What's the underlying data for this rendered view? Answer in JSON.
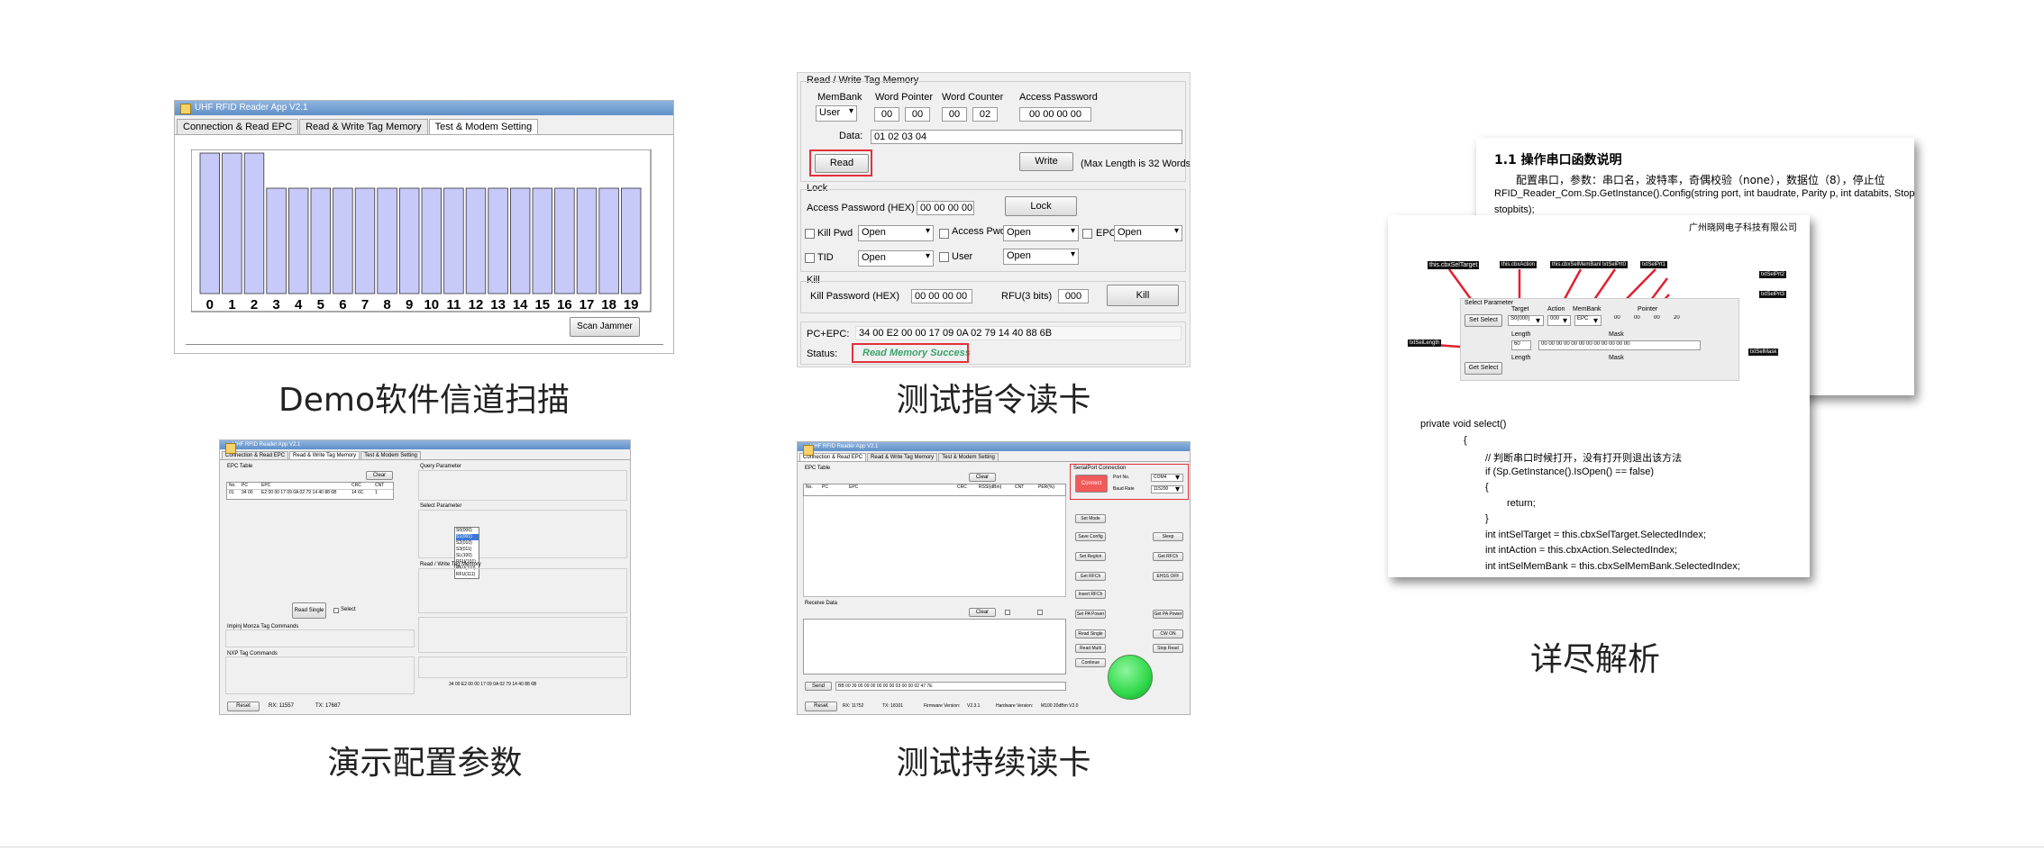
{
  "captions": {
    "demo_scan": "Demo软件信道扫描",
    "read_cmd": "测试指令读卡",
    "analysis": "详尽解析",
    "config": "演示配置参数",
    "continuous": "测试持续读卡"
  },
  "app": {
    "title": "UHF RFID Reader App V2.1",
    "tab_connection": "Connection & Read EPC",
    "tab_rw": "Read & Write Tag Memory",
    "tab_test": "Test & Modem Setting"
  },
  "scan": {
    "channels": [
      "0",
      "1",
      "2",
      "3",
      "4",
      "5",
      "6",
      "7",
      "8",
      "9",
      "10",
      "11",
      "12",
      "13",
      "14",
      "15",
      "16",
      "17",
      "18",
      "19"
    ],
    "levels": [
      1.0,
      1.0,
      1.0,
      0.75,
      0.75,
      0.75,
      0.75,
      0.75,
      0.75,
      0.75,
      0.75,
      0.75,
      0.75,
      0.75,
      0.75,
      0.75,
      0.75,
      0.75,
      0.75,
      0.75
    ],
    "bar_color": "#c7c9f9",
    "scan_button": "Scan Jammer"
  },
  "rw": {
    "group_title": "Read / Write Tag Memory",
    "membank_label": "MemBank",
    "membank_value": "User",
    "word_pointer_label": "Word Pointer",
    "wp1": "00",
    "wp2": "00",
    "word_counter_label": "Word Counter",
    "wc1": "00",
    "wc2": "02",
    "access_password_label": "Access Password",
    "access_password_value": "00 00 00 00",
    "data_label": "Data:",
    "data_value": "01  02  03  04",
    "read_button": "Read",
    "write_button": "Write",
    "max_length": "(Max Length is 32 Words)",
    "lock_title": "Lock",
    "lock_pw_label": "Access Password (HEX)",
    "lock_pw_value": "00 00 00 00",
    "lock_button": "Lock",
    "kill_pwd_label": "Kill Pwd",
    "access_pwd_label": "Access Pwd",
    "epc_label": "EPC",
    "tid_label": "TID",
    "user_label": "User",
    "open": "Open",
    "kill_title": "Kill",
    "kill_pw_label": "Kill Password (HEX)",
    "kill_pw_value": "00 00 00 00",
    "rfu_label": "RFU(3 bits)",
    "rfu_value": "000",
    "kill_button": "Kill",
    "pcepc_label": "PC+EPC:",
    "pcepc_value": "34 00 E2 00 00 17 09 0A 02 79 14 40 88 6B",
    "status_label": "Status:",
    "status_value": "Read Memory Success",
    "status_color": "#3aa36a"
  },
  "doc": {
    "back_section": "1.1    操作串口函数说明",
    "back_para": "配置串口，参数：串口名，波特率，奇偶校验（none），数据位（8），停止位",
    "back_code": "RFID_Reader_Com.Sp.GetInstance().Config(string port, int baudrate, Parity p, int databits, StopBits",
    "back_code2": "stopbits);",
    "company": "广州晓网电子科技有限公司",
    "tags": [
      "this.cbxSelTarget",
      "this.cbxAction",
      "this.cbxSelMemBank",
      "txtSelPrt0",
      "txtSelPrt1",
      "txtSelPrt2",
      "txtSelPrt3",
      "txtSelLength",
      "txtSelMask"
    ],
    "sp_title": "Select Parameter",
    "sp_target": "Target",
    "sp_action": "Action",
    "sp_membank": "MemBank",
    "sp_pointer": "Pointer",
    "sp_set_select": "Set Select",
    "sp_target_val": "S0(000)",
    "sp_action_val": "000",
    "sp_membank_val": "EPC",
    "sp_p1": "00",
    "sp_p2": "00",
    "sp_p3": "00",
    "sp_p4": "20",
    "sp_length": "Length",
    "sp_mask": "Mask",
    "sp_len_val": "60",
    "sp_mask_val": "00 00 00 00 00 00 00 00 00 00 00 00",
    "sp_get_select": "Get Select",
    "code": [
      "private void select()",
      "{",
      "// 判断串口时候打开，没有打开则退出该方法",
      "if (Sp.GetInstance().IsOpen() == false)",
      "{",
      "return;",
      "}",
      "int intSelTarget = this.cbxSelTarget.SelectedIndex;",
      "int intAction = this.cbxAction.SelectedIndex;",
      "int intSelMemBank = this.cbxSelMemBank.SelectedIndex;"
    ]
  },
  "thumb_config": {
    "epc_table": "EPC Table",
    "clear": "Clear",
    "headers": [
      "No.",
      "PC",
      "EPC",
      "CRC",
      "CNT"
    ],
    "row": [
      "01",
      "34 00",
      "E2 00 00 17 09 0A 02 79 14 40 88 6B",
      "14 6C",
      "1"
    ],
    "query_param": "Query Parameter",
    "select_param": "Select Parameter",
    "rw": "Read / Write Tag Memory",
    "read_single": "Read Single",
    "select": "Select",
    "impinj": "Impinj Monza Tag Commands",
    "nxp": "NXP Tag Commands",
    "reset": "Reset",
    "rx": "RX:  11557",
    "tx": "TX:  17687",
    "dropdown": [
      "S0(000)",
      "S1(001)",
      "S2(010)",
      "S3(011)",
      "SL(100)",
      "RFU(101)",
      "RFU(110)",
      "RFU(111)"
    ],
    "pcepc": "34 00 E2 00 00 17 09 0A 02 79 14 40 88 6B"
  },
  "thumb_cont": {
    "epc_table": "EPC Table",
    "clear": "Clear",
    "headers": [
      "No.",
      "PC",
      "EPC",
      "CRC",
      "RSSI(dBm)",
      "CNT",
      "PER(%)"
    ],
    "serial": "SerialPort Connection",
    "connect": "Connect",
    "port": "Port No.",
    "port_val": "COM4",
    "baud": "Baud Rate",
    "baud_val": "115200",
    "receive": "Receive Data",
    "send": "Send",
    "send_data": "BB 00 39 00 09 00 00 00 00 03 00 00 02 47 7E",
    "reset": "Reset",
    "rx": "RX:  11752",
    "tx": "TX:  18101",
    "fw": "Firmware Version:",
    "fw_val": "V2.3.1",
    "hw": "Hardware Version:",
    "hw_val": "M100 20dBm V2.0",
    "indicator_color": "#2fd94a",
    "buttons": [
      "Set Mode",
      "Save Config",
      "Set Region",
      "Get RFCh",
      "Insert RFCh",
      "Set PA Power",
      "Read Single",
      "Read Multi",
      "Continue",
      "Sleep",
      "Get RFCh",
      "EHSS OFF",
      "Get PA Power",
      "CW ON",
      "Stop Read"
    ]
  }
}
